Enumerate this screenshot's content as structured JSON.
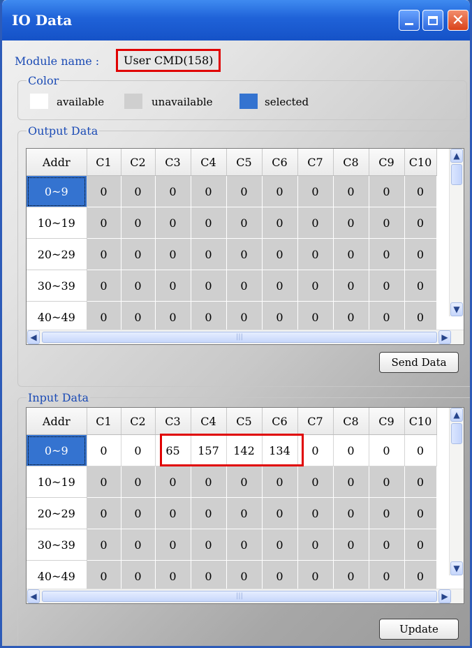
{
  "window": {
    "title": "IO Data"
  },
  "module": {
    "label": "Module name :",
    "value": "User CMD(158)"
  },
  "color_group": {
    "legend": "Color",
    "items": [
      {
        "label": "available",
        "color": "#ffffff"
      },
      {
        "label": "unavailable",
        "color": "#cfcfcf"
      },
      {
        "label": "selected",
        "color": "#3473d0"
      }
    ]
  },
  "output": {
    "legend": "Output Data",
    "columns": [
      "Addr",
      "C1",
      "C2",
      "C3",
      "C4",
      "C5",
      "C6",
      "C7",
      "C8",
      "C9",
      "C10"
    ],
    "rows": [
      [
        "0~9",
        "0",
        "0",
        "0",
        "0",
        "0",
        "0",
        "0",
        "0",
        "0",
        "0"
      ],
      [
        "10~19",
        "0",
        "0",
        "0",
        "0",
        "0",
        "0",
        "0",
        "0",
        "0",
        "0"
      ],
      [
        "20~29",
        "0",
        "0",
        "0",
        "0",
        "0",
        "0",
        "0",
        "0",
        "0",
        "0"
      ],
      [
        "30~39",
        "0",
        "0",
        "0",
        "0",
        "0",
        "0",
        "0",
        "0",
        "0",
        "0"
      ],
      [
        "40~49",
        "0",
        "0",
        "0",
        "0",
        "0",
        "0",
        "0",
        "0",
        "0",
        "0"
      ]
    ],
    "button_label": "Send Data"
  },
  "input": {
    "legend": "Input Data",
    "columns": [
      "Addr",
      "C1",
      "C2",
      "C3",
      "C4",
      "C5",
      "C6",
      "C7",
      "C8",
      "C9",
      "C10"
    ],
    "rows": [
      [
        "0~9",
        "0",
        "0",
        "65",
        "157",
        "142",
        "134",
        "0",
        "0",
        "0",
        "0"
      ],
      [
        "10~19",
        "0",
        "0",
        "0",
        "0",
        "0",
        "0",
        "0",
        "0",
        "0",
        "0"
      ],
      [
        "20~29",
        "0",
        "0",
        "0",
        "0",
        "0",
        "0",
        "0",
        "0",
        "0",
        "0"
      ],
      [
        "30~39",
        "0",
        "0",
        "0",
        "0",
        "0",
        "0",
        "0",
        "0",
        "0",
        "0"
      ],
      [
        "40~49",
        "0",
        "0",
        "0",
        "0",
        "0",
        "0",
        "0",
        "0",
        "0",
        "0"
      ]
    ],
    "button_label": "Update"
  },
  "scroll": {
    "up": "▲",
    "down": "▼",
    "left": "◀",
    "right": "▶",
    "grip": "|||"
  }
}
